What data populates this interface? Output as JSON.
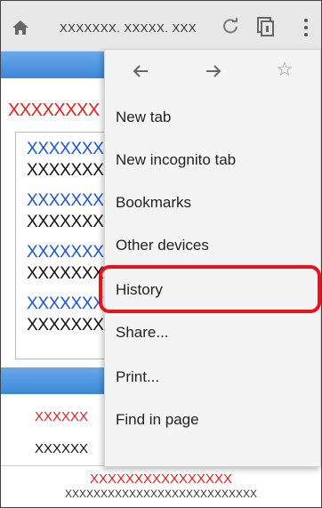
{
  "toolbar": {
    "url": "XXXXXXX. XXXXX. XXX",
    "home_icon": "home-icon",
    "reload_icon": "reload-icon",
    "tabs_icon": "tab-switcher-icon",
    "menu_icon": "overflow-menu-icon"
  },
  "page": {
    "red_heading": "XXXXXXXX",
    "card_lines": [
      {
        "text": "XXXXXXX",
        "color": "blue"
      },
      {
        "text": "XXXXXXX",
        "color": "black"
      },
      {
        "text": "XXXXXXX",
        "color": "blue"
      },
      {
        "text": "XXXXXXX",
        "color": "black"
      },
      {
        "text": "XXXXXXX",
        "color": "blue"
      },
      {
        "text": "XXXXXXX",
        "color": "black"
      },
      {
        "text": "XXXXXXX",
        "color": "blue"
      },
      {
        "text": "XXXXXXX",
        "color": "black"
      }
    ],
    "row_red": "XXXXXX",
    "row_black": "XXXXXX",
    "footer_red": "XXXXXXXXXXXXXXXX",
    "footer_black": "XXXXXXXXXXXXXXXXXXXXXXXXXXX"
  },
  "menu": {
    "back_icon": "back-arrow-icon",
    "forward_icon": "forward-arrow-icon",
    "bookmark_icon": "star-icon",
    "items": [
      "New tab",
      "New incognito tab",
      "Bookmarks",
      "Other devices",
      "History",
      "Share...",
      "Print...",
      "Find in page"
    ],
    "highlighted_item": "History"
  },
  "colors": {
    "highlight": "#e8141d",
    "link_blue": "#1a56d6",
    "accent_red": "#e0201f",
    "bar_blue": "#3d86d8"
  }
}
